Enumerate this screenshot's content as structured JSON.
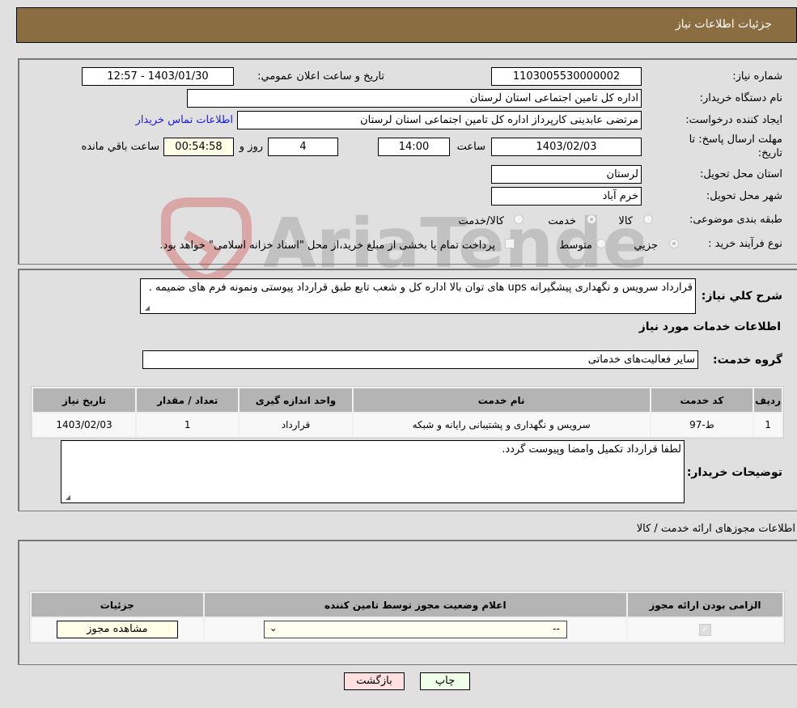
{
  "header": {
    "title": "جزئیات اطلاعات نیاز"
  },
  "details": {
    "need_number_label": "شماره نیاز:",
    "need_number": "1103005530000002",
    "announce_label": "تاریخ و ساعت اعلان عمومي:",
    "announce_value": "1403/01/30 - 12:57",
    "buyer_org_label": "نام دستگاه خریدار:",
    "buyer_org": "اداره کل تامین اجتماعی استان لرستان",
    "requester_label": "ایجاد کننده درخواست:",
    "requester": "مرتضی عابدینی کارپرداز اداره کل تامین اجتماعی استان لرستان",
    "contact_link": "اطلاعات تماس خریدار",
    "deadline_label_1": "مهلت ارسال پاسخ: تا",
    "deadline_label_2": "تاریخ:",
    "deadline_date": "1403/02/03",
    "time_label": "ساعت",
    "deadline_time": "14:00",
    "days_value": "4",
    "days_label": "روز و",
    "remaining_time": "00:54:58",
    "remaining_label": "ساعت باقي مانده",
    "province_label": "استان محل تحویل:",
    "province": "لرستان",
    "city_label": "شهر محل تحویل:",
    "city": "خرم آباد",
    "category_label": "طبقه بندی موضوعی:",
    "category_options": [
      {
        "label": "کالا",
        "selected": false
      },
      {
        "label": "خدمت",
        "selected": true
      },
      {
        "label": "کالا/خدمت",
        "selected": false
      }
    ],
    "process_label": "نوع فرآیند خرید :",
    "process_options": [
      {
        "label": "جزيي",
        "selected": true
      },
      {
        "label": "متوسط",
        "selected": false
      }
    ],
    "treasury_note": "پرداخت تمام یا بخشی از مبلغ خرید،از محل \"اسناد خزانه اسلامی\" خواهد بود."
  },
  "description": {
    "label": "شرح کلي نیاز:",
    "text": "قرارداد سرویس و نگهداری پیشگیرانه ups های توان بالا اداره کل و شعب تابع طبق قرارداد پیوستی ونمونه فرم های ضمیمه ."
  },
  "services": {
    "section_title": "اطلاعات خدمات مورد نیاز",
    "group_label": "گروه خدمت:",
    "group_value": "سایر فعالیت‌های خدماتی",
    "columns": [
      "ردیف",
      "کد خدمت",
      "نام خدمت",
      "واحد اندازه گیری",
      "تعداد / مقدار",
      "تاریخ نیاز"
    ],
    "rows": [
      [
        "1",
        "ط-97",
        "سرویس و نگهداری و پشتیبانی رایانه و شبکه",
        "قرارداد",
        "1",
        "1403/02/03"
      ]
    ]
  },
  "buyer_notes": {
    "label": "توضیحات خریدار:",
    "text": "لطفا قرارداد تکمیل وامضا وپیوست گردد."
  },
  "permits": {
    "section_title": "اطلاعات مجوزهای ارائه خدمت / کالا",
    "columns": [
      "الزامی بودن ارائه مجوز",
      "اعلام وضعیت مجوز توسط تامین کننده",
      "جزئیات"
    ],
    "rows": [
      {
        "required": true,
        "status_selected": "--",
        "details_button": "مشاهده مجوز"
      }
    ]
  },
  "footer": {
    "print_button": "چاپ",
    "back_button": "بازگشت"
  },
  "colors": {
    "header_bg": "#8b6d42",
    "print_bg": "#efffe8",
    "back_bg": "#ffe0e0",
    "link": "#1a1ad6"
  }
}
